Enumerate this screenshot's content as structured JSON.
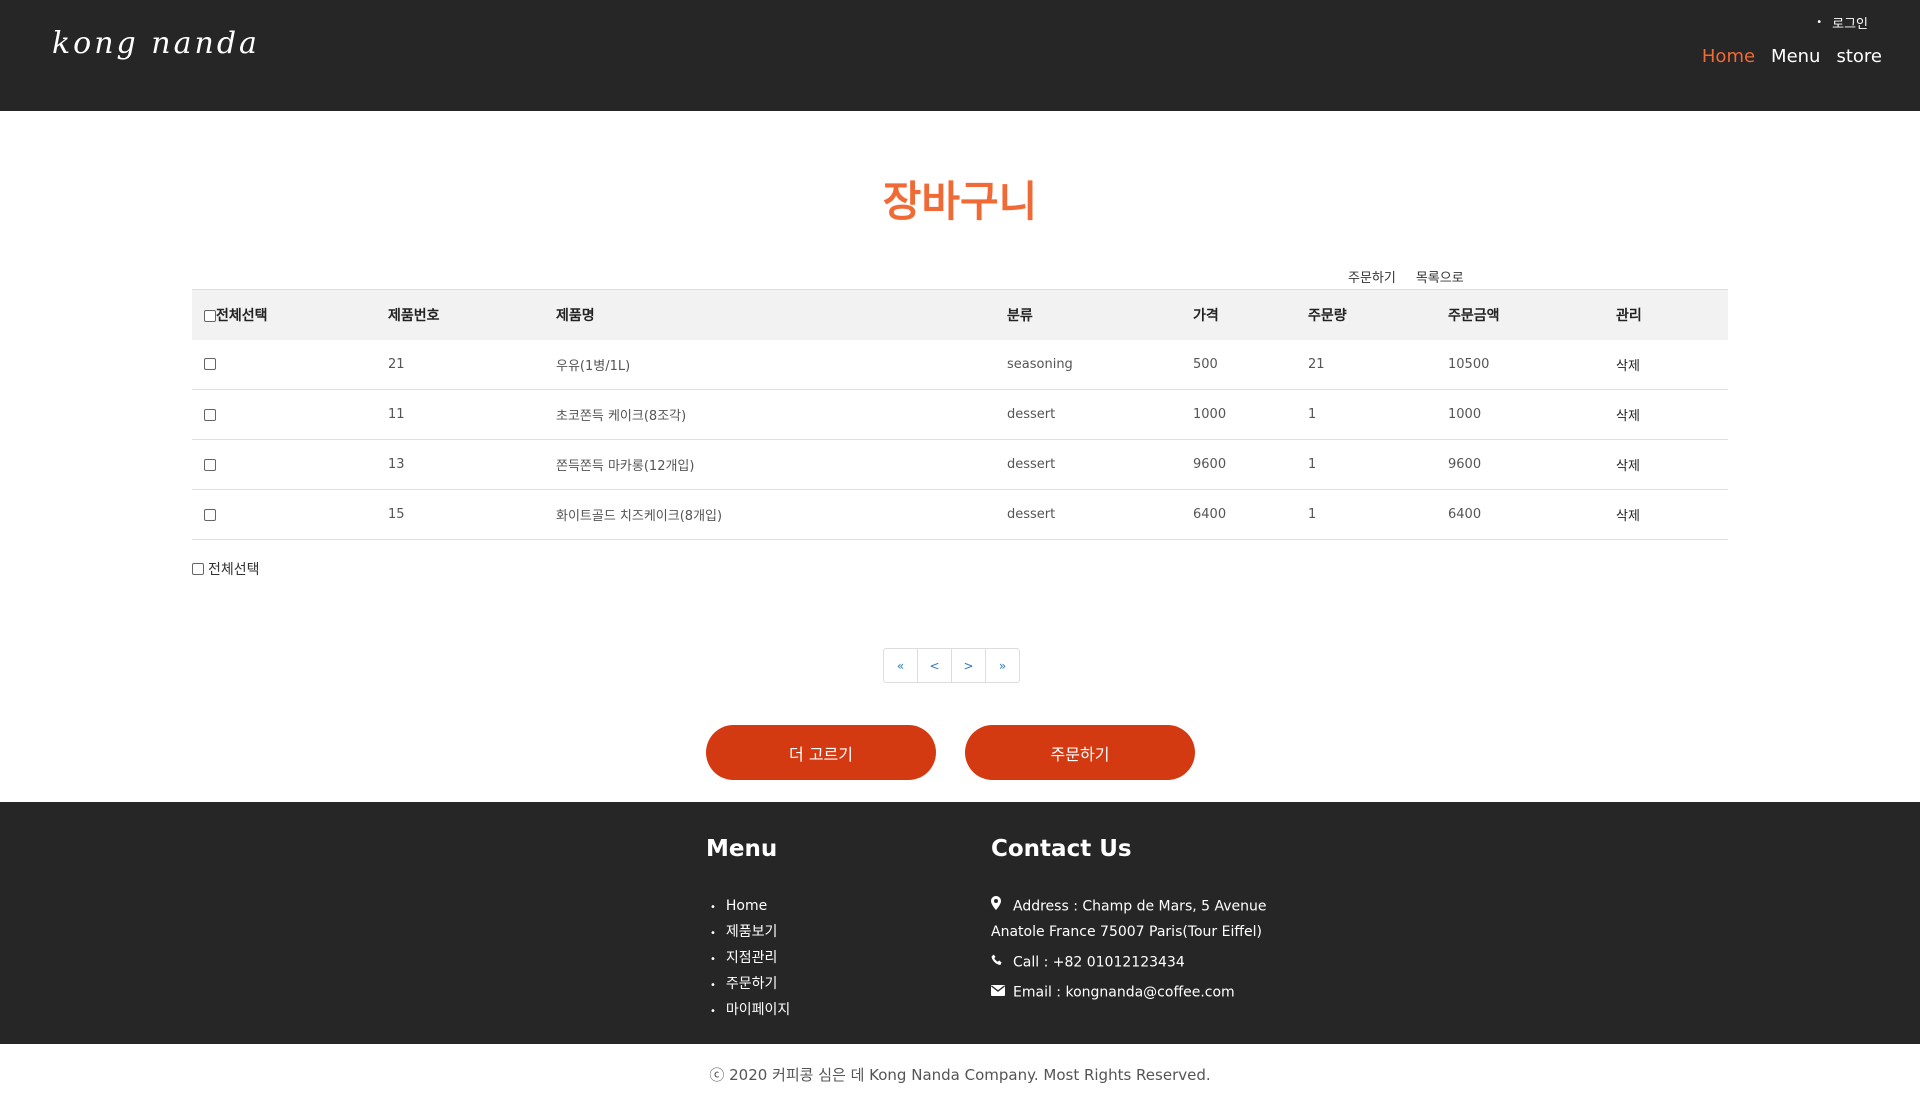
{
  "header": {
    "logo_text": "kong nanda",
    "login_label": "로그인",
    "nav": [
      {
        "label": "Home",
        "active": true
      },
      {
        "label": "Menu",
        "active": false
      },
      {
        "label": "store",
        "active": false
      }
    ]
  },
  "page_title": "장바구니",
  "top_links": [
    "주문하기",
    "목록으로"
  ],
  "table": {
    "headers": [
      "전체선택",
      "제품번호",
      "제품명",
      "분류",
      "가격",
      "주문량",
      "주문금액",
      "관리"
    ],
    "rows": [
      {
        "id": "21",
        "name": "우유(1병/1L)",
        "category": "seasoning",
        "price": "500",
        "qty": "21",
        "amount": "10500",
        "action": "삭제"
      },
      {
        "id": "11",
        "name": "초코쫀득 케이크(8조각)",
        "category": "dessert",
        "price": "1000",
        "qty": "1",
        "amount": "1000",
        "action": "삭제"
      },
      {
        "id": "13",
        "name": "쫀득쫀득 마카롱(12개입)",
        "category": "dessert",
        "price": "9600",
        "qty": "1",
        "amount": "9600",
        "action": "삭제"
      },
      {
        "id": "15",
        "name": "화이트골드 치즈케이크(8개입)",
        "category": "dessert",
        "price": "6400",
        "qty": "1",
        "amount": "6400",
        "action": "삭제"
      }
    ]
  },
  "select_all_label": "전체선택",
  "pager": [
    "«",
    "<",
    ">",
    "»"
  ],
  "buttons": {
    "more": "더 고르기",
    "order": "주문하기"
  },
  "footer": {
    "menu_title": "Menu",
    "menu_items": [
      "Home",
      "제품보기",
      "지점관리",
      "주문하기",
      "마이페이지"
    ],
    "contact_title": "Contact Us",
    "address_line1": "Address : Champ de Mars, 5 Avenue",
    "address_line2": "Anatole France 75007 Paris(Tour Eiffel)",
    "call": "Call : +82 01012123434",
    "email": "Email : kongnanda@coffee.com"
  },
  "copyright": "ⓒ 2020 커피콩 심은 데 Kong Nanda Company. Most Rights Reserved.",
  "colors": {
    "accent": "#f06a35",
    "button": "#d43a12",
    "dark": "#262626"
  }
}
